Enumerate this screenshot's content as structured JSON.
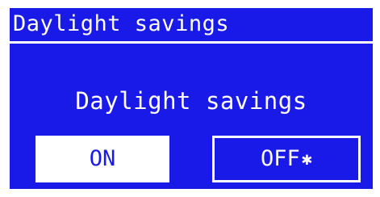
{
  "header": {
    "title": "Daylight savings"
  },
  "prompt": {
    "text": "Daylight savings"
  },
  "options": {
    "on_label": "ON",
    "off_label": "OFF",
    "off_marker_icon": "current-selection-marker-icon",
    "off_marker_glyph": "✱",
    "selected": "ON"
  },
  "colors": {
    "background": "#1a1ae8",
    "foreground": "#ffffff"
  }
}
